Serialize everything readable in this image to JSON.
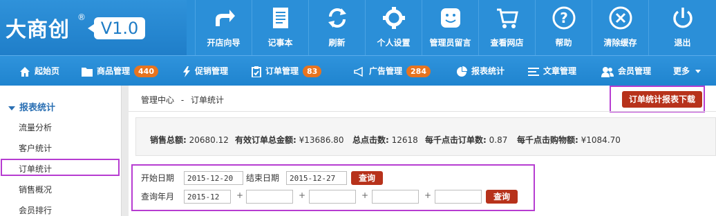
{
  "brand": {
    "name": "大商创",
    "reg": "®",
    "version": "V1.0"
  },
  "toolbar": [
    {
      "label": "开店向导",
      "icon": "share-arrow-icon"
    },
    {
      "label": "记事本",
      "icon": "notepad-icon"
    },
    {
      "label": "刷新",
      "icon": "refresh-icon"
    },
    {
      "label": "个人设置",
      "icon": "gear-icon"
    },
    {
      "label": "管理员留言",
      "icon": "smiley-icon"
    },
    {
      "label": "查看网店",
      "icon": "cart-icon"
    },
    {
      "label": "帮助",
      "icon": "help-icon"
    },
    {
      "label": "清除缓存",
      "icon": "clear-icon"
    },
    {
      "label": "退出",
      "icon": "power-icon"
    }
  ],
  "nav": [
    {
      "label": "起始页",
      "icon": "home-icon"
    },
    {
      "label": "商品管理",
      "icon": "folder-icon",
      "badge": "440"
    },
    {
      "label": "促销管理",
      "icon": "bolt-icon"
    },
    {
      "label": "订单管理",
      "icon": "clipboard-icon",
      "badge": "83"
    },
    {
      "label": "广告管理",
      "icon": "megaphone-icon",
      "badge": "284"
    },
    {
      "label": "报表统计",
      "icon": "pie-chart-icon"
    },
    {
      "label": "文章管理",
      "icon": "list-icon"
    },
    {
      "label": "会员管理",
      "icon": "users-icon"
    },
    {
      "label": "更多",
      "icon": "caret-down-icon"
    }
  ],
  "sidebar": {
    "section": "报表统计",
    "items": [
      {
        "label": "流量分析"
      },
      {
        "label": "客户统计"
      },
      {
        "label": "订单统计"
      },
      {
        "label": "销售概况"
      },
      {
        "label": "会员排行"
      }
    ]
  },
  "breadcrumb": {
    "root": "管理中心",
    "sep": "-",
    "current": "订单统计"
  },
  "download_button": "订单统计报表下载",
  "stats": [
    {
      "label": "销售总额:",
      "value": "20680.12"
    },
    {
      "label": "有效订单总金额:",
      "value": "¥13686.80"
    },
    {
      "label": "总点击数:",
      "value": "12618"
    },
    {
      "label": "每千点击订单数:",
      "value": "0.87"
    },
    {
      "label": "每千点击购物额:",
      "value": "¥1084.70"
    }
  ],
  "query": {
    "start_label": "开始日期",
    "start_value": "2015-12-20",
    "end_label": "结束日期",
    "end_value": "2015-12-27",
    "query_button": "查询",
    "month_label": "查询年月",
    "month_values": [
      "2015-12",
      "",
      "",
      "",
      ""
    ],
    "plus": "+",
    "month_button": "查询"
  },
  "colors": {
    "brand_blue": "#2b8fd8",
    "accent_red": "#b7321b",
    "badge_orange": "#e8741f",
    "highlight_purple": "#b63cd1"
  }
}
